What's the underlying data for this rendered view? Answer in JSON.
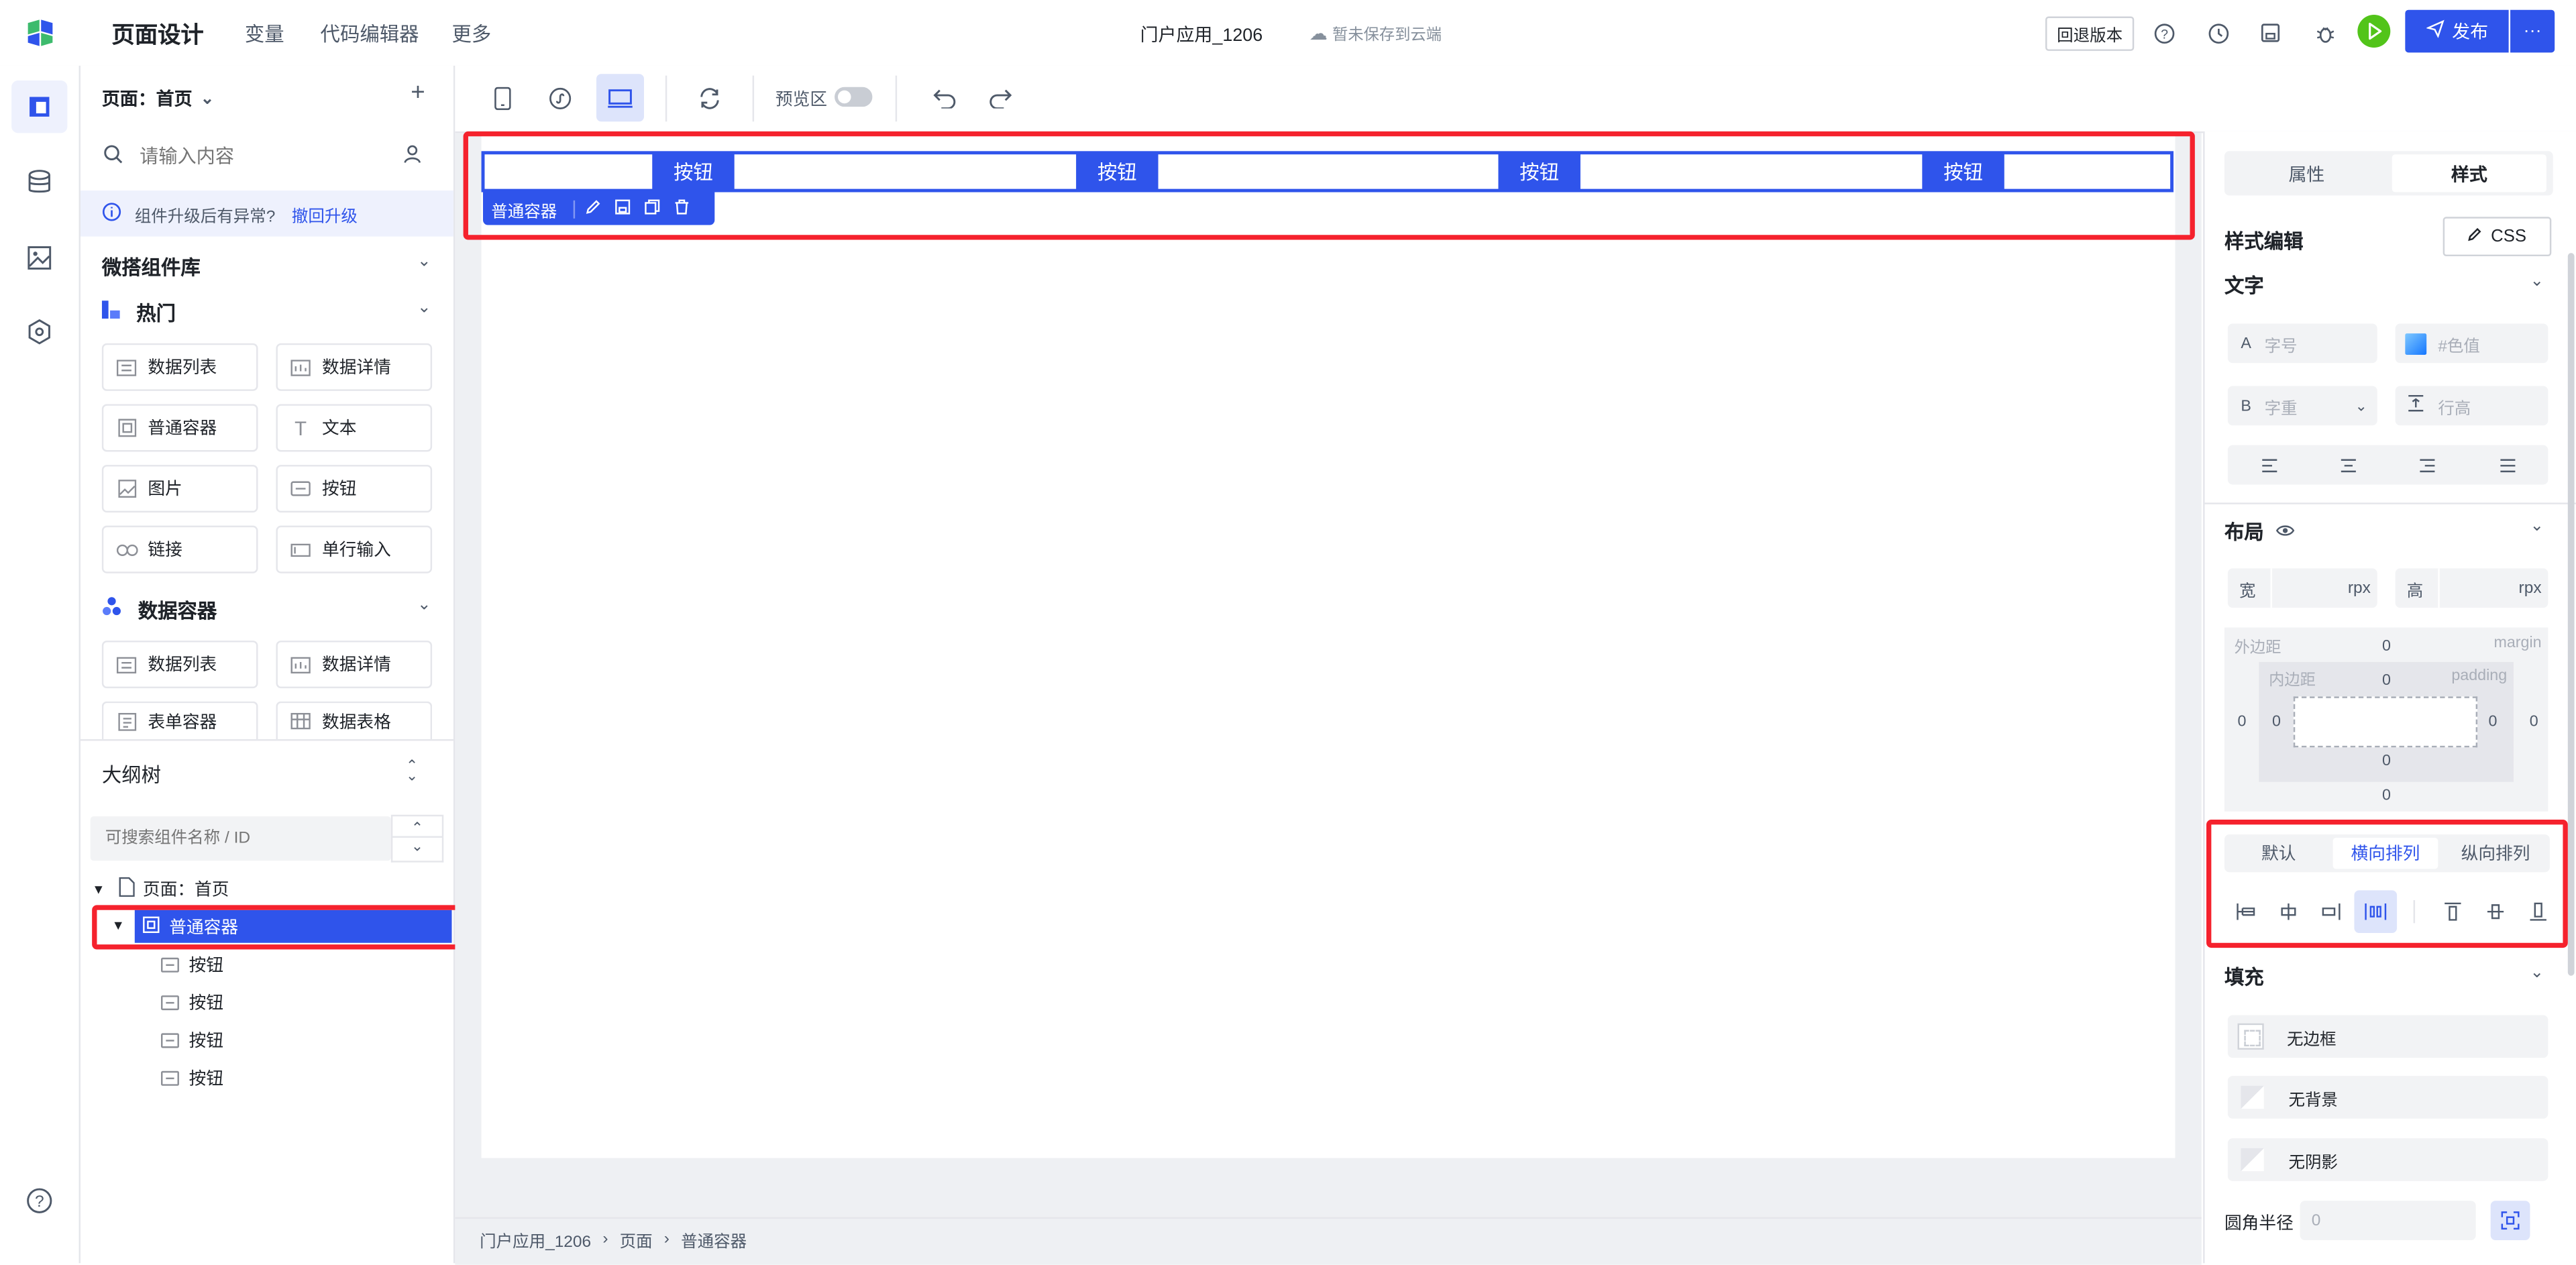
{
  "header": {
    "title": "页面设计",
    "nav": [
      "变量",
      "代码编辑器",
      "更多"
    ],
    "app_name": "门户应用_1206",
    "save_status": "暂未保存到云端",
    "rollback_label": "回退版本",
    "publish_label": "发布",
    "more_label": "···"
  },
  "left_panel": {
    "page_selector": "页面：首页",
    "search_placeholder": "请输入内容",
    "upgrade_notice": "组件升级后有异常?",
    "upgrade_link": "撤回升级",
    "library_title": "微搭组件库",
    "hot_title": "热门",
    "hot_items": [
      "数据列表",
      "数据详情",
      "普通容器",
      "文本",
      "图片",
      "按钮",
      "链接",
      "单行输入"
    ],
    "data_title": "数据容器",
    "data_items": [
      "数据列表",
      "数据详情",
      "表单容器",
      "数据表格"
    ],
    "outline_title": "大纲树",
    "outline_search_placeholder": "可搜索组件名称 / ID",
    "tree": {
      "root": "页面：首页",
      "container": "普通容器",
      "children": [
        "按钮",
        "按钮",
        "按钮",
        "按钮"
      ]
    }
  },
  "toolbar": {
    "preview_label": "预览区"
  },
  "canvas": {
    "buttons": [
      "按钮",
      "按钮",
      "按钮",
      "按钮"
    ],
    "selected_label": "普通容器"
  },
  "breadcrumb": [
    "门户应用_1206",
    "页面",
    "普通容器"
  ],
  "right_panel": {
    "tabs": [
      "属性",
      "样式"
    ],
    "active_tab": "样式",
    "style_edit_title": "样式编辑",
    "css_button": "CSS",
    "text_section": "文字",
    "font_size_prefix": "A",
    "font_size_placeholder": "字号",
    "color_placeholder": "#色值",
    "weight_prefix": "B",
    "weight_placeholder": "字重",
    "line_height_placeholder": "行高",
    "layout_section": "布局",
    "width_label": "宽",
    "height_label": "高",
    "unit": "rpx",
    "margin_label": "外边距",
    "margin_en": "margin",
    "padding_label": "内边距",
    "padding_en": "padding",
    "zero": "0",
    "arrange_tabs": [
      "默认",
      "横向排列",
      "纵向排列"
    ],
    "active_arrange": "横向排列",
    "fill_section": "填充",
    "no_border": "无边框",
    "no_background": "无背景",
    "no_shadow": "无阴影",
    "radius_label": "圆角半径",
    "radius_value": "0"
  },
  "colors": {
    "primary": "#2f54eb",
    "highlight": "#f5222d",
    "play": "#52c41a"
  }
}
